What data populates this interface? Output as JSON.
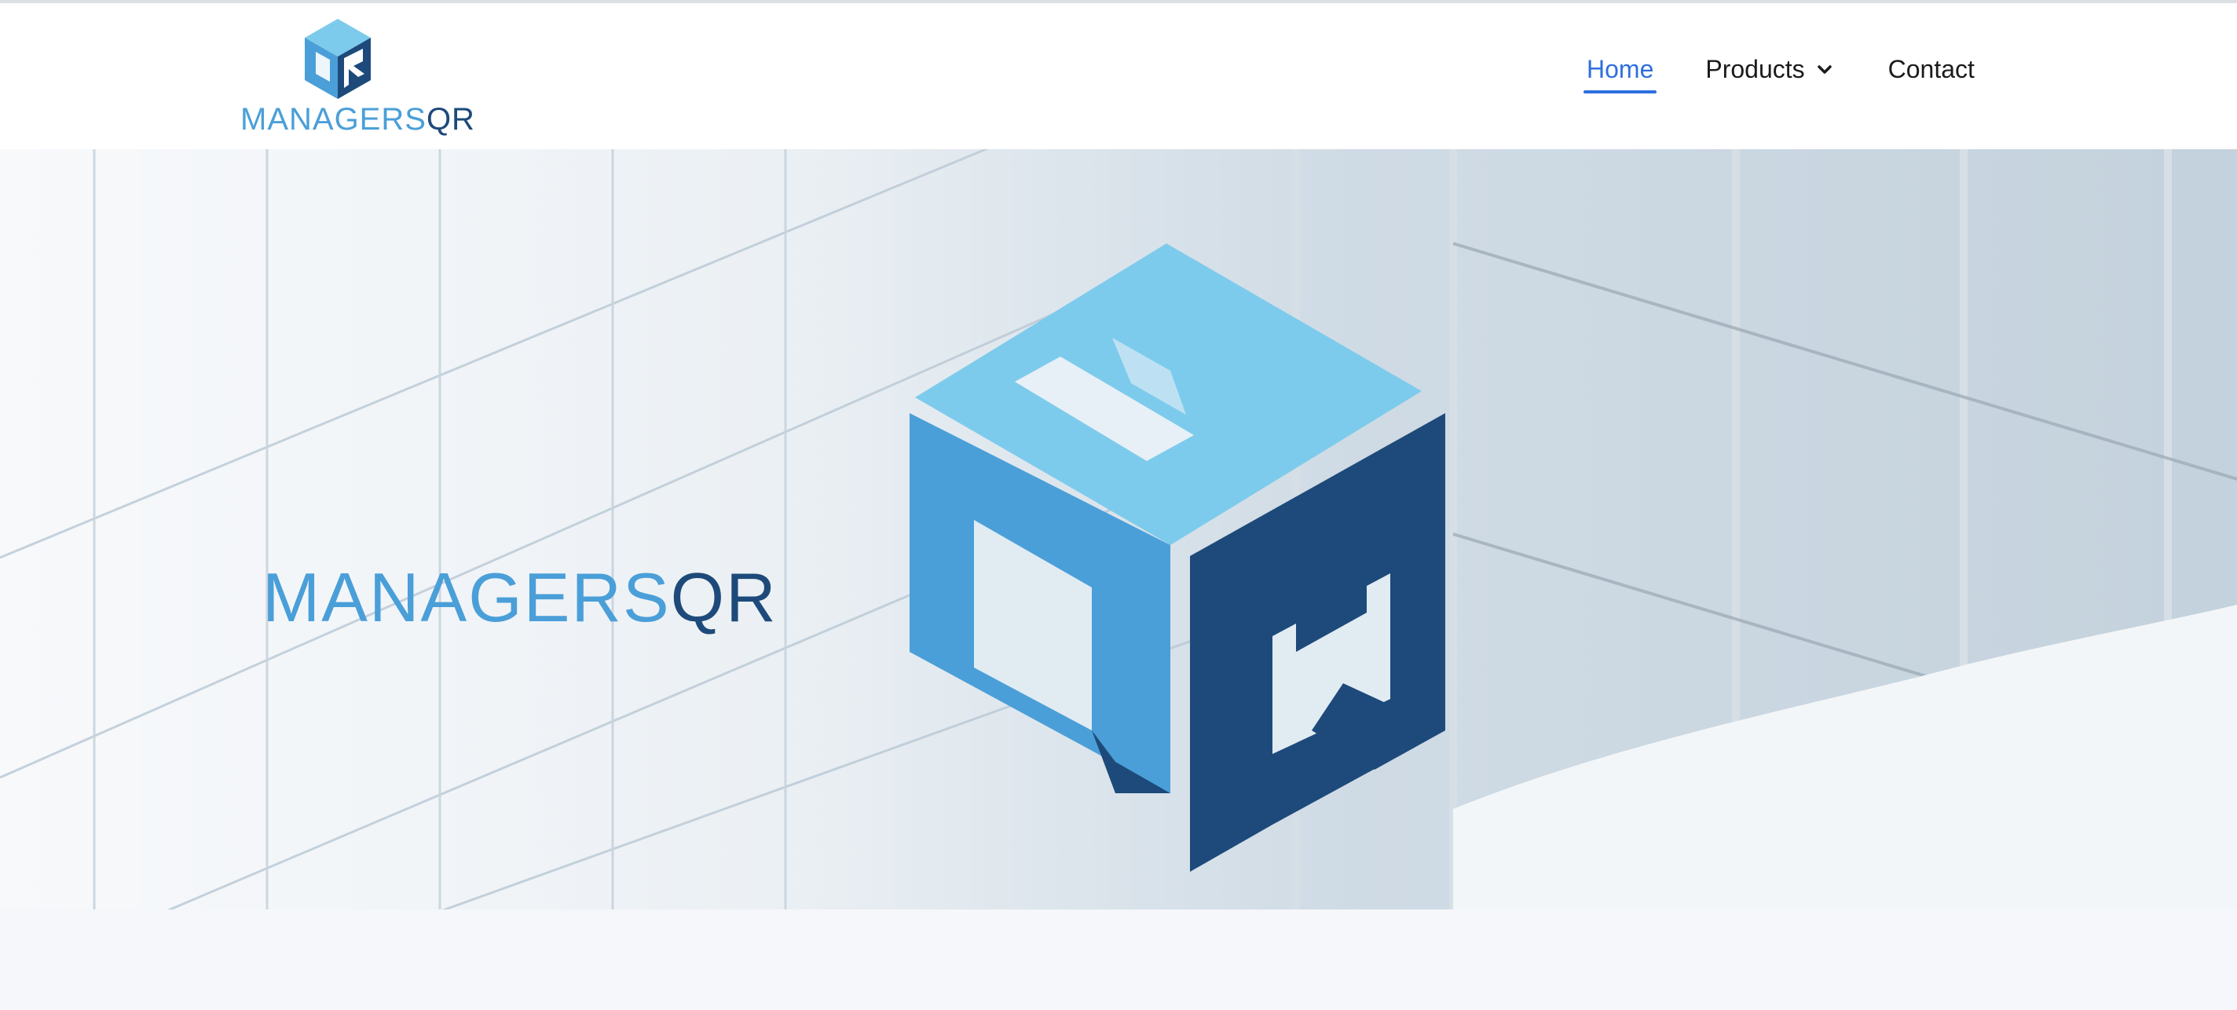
{
  "brand": {
    "name_primary": "MANAGERS",
    "name_secondary": "QR"
  },
  "nav": {
    "items": [
      {
        "label": "Home",
        "active": true
      },
      {
        "label": "Products",
        "has_dropdown": true
      },
      {
        "label": "Contact"
      }
    ]
  },
  "hero": {
    "title_primary": "MANAGERS",
    "title_secondary": "QR"
  },
  "colors": {
    "logo_light": "#7dcbec",
    "logo_mid": "#4a9fd8",
    "logo_dark": "#1d4a7a",
    "nav_active": "#2f6fdf"
  },
  "icons": {
    "logo": "mqr-cube-logo",
    "dropdown": "chevron-down-icon"
  }
}
